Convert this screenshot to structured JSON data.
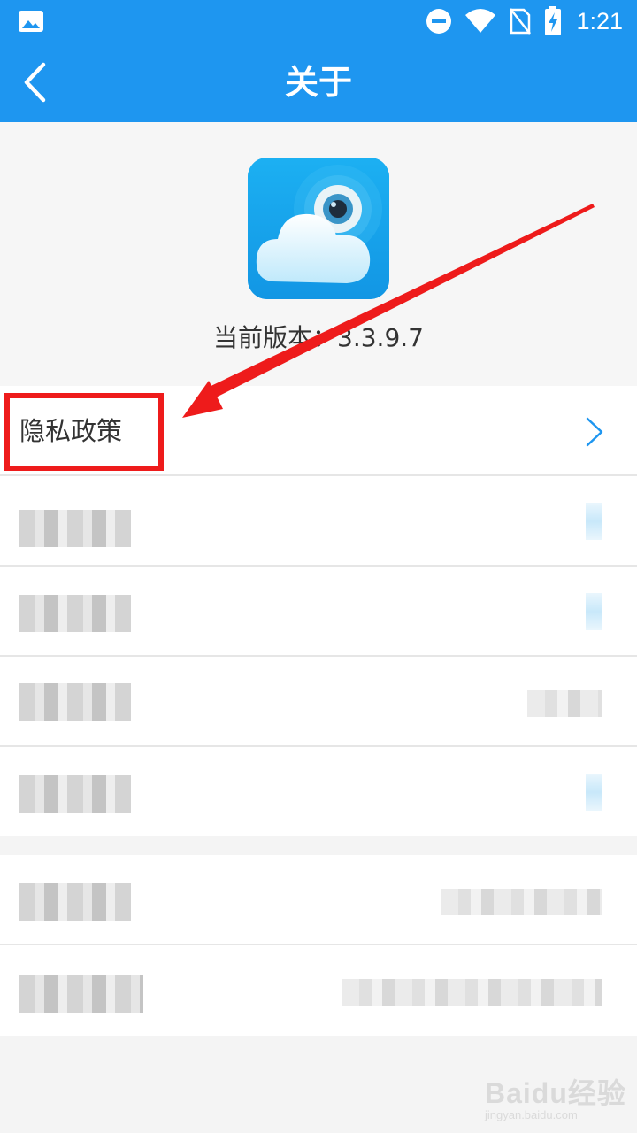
{
  "status_bar": {
    "time": "1:21",
    "icons": [
      "image-icon",
      "dnd-icon",
      "wifi-icon",
      "no-sim-icon",
      "battery-charging-icon"
    ]
  },
  "app_bar": {
    "title": "关于",
    "back_icon": "chevron-left-icon"
  },
  "about": {
    "logo_icon": "cloud-camera-logo",
    "version_text": "当前版本：3.3.9.7"
  },
  "list_group_1": [
    {
      "label": "隐私政策",
      "has_chevron": true,
      "blurred": false
    },
    {
      "label": "",
      "blurred": true
    },
    {
      "label": "",
      "blurred": true
    },
    {
      "label": "",
      "blurred": true
    },
    {
      "label": "",
      "blurred": true
    }
  ],
  "list_group_2": [
    {
      "label": "",
      "blurred": true
    },
    {
      "label": "",
      "blurred": true
    }
  ],
  "annotation": {
    "highlight_color": "#ee1b1b",
    "target": "隐私政策"
  },
  "watermark": {
    "brand": "Baidu经验",
    "url": "jingyan.baidu.com"
  },
  "colors": {
    "primary": "#1e96f0",
    "background": "#f4f4f4",
    "chevron": "#1e96f0"
  }
}
